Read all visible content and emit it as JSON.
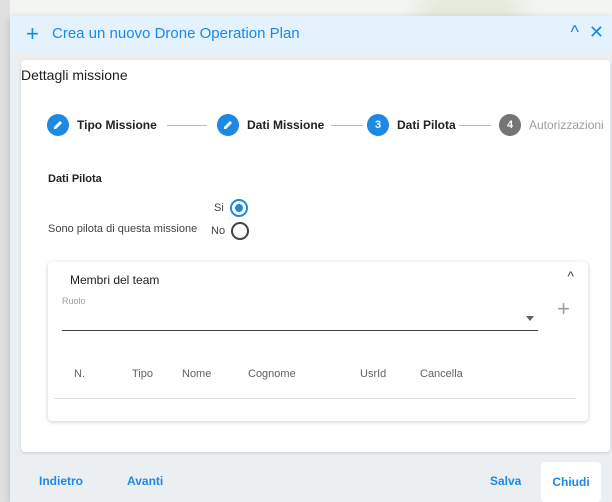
{
  "dialog": {
    "title": "Crea un nuovo Drone Operation Plan",
    "plus_glyph": "+",
    "collapse_glyph": "^",
    "close_glyph": "✕"
  },
  "card": {
    "title": "Dettagli missione"
  },
  "stepper": {
    "steps": [
      {
        "label": "Tipo Missione",
        "state": "done",
        "icon": "pencil-icon"
      },
      {
        "label": "Dati Missione",
        "state": "done",
        "icon": "pencil-icon"
      },
      {
        "label": "Dati Pilota",
        "state": "active",
        "number": "3"
      },
      {
        "label": "Autorizzazioni",
        "state": "todo",
        "number": "4"
      }
    ]
  },
  "pilot": {
    "section_title": "Dati Pilota",
    "question": "Sono pilota di questa missione",
    "options": [
      {
        "label": "Si",
        "checked": true
      },
      {
        "label": "No",
        "checked": false
      }
    ]
  },
  "team": {
    "title": "Membri del team",
    "role_label": "Ruolo",
    "role_value": "",
    "add_glyph": "+",
    "collapse_glyph": "^",
    "columns": [
      "N.",
      "Tipo",
      "Nome",
      "Cognome",
      "UsrId",
      "Cancella"
    ]
  },
  "footer": {
    "back": "Indietro",
    "next": "Avanti",
    "save": "Salva",
    "close": "Chiudi"
  },
  "colors": {
    "accent": "#1e88e5",
    "titlebar_bg": "#e3f2fd",
    "step_todo": "#757575"
  }
}
